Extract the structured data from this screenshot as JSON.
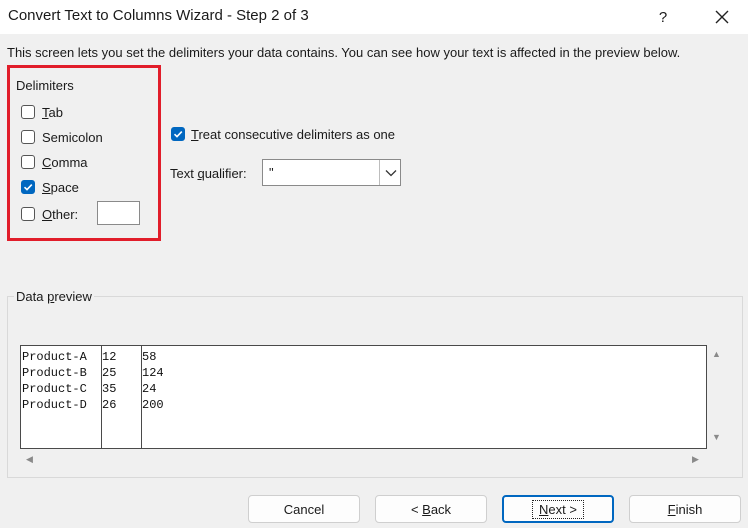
{
  "window": {
    "title": "Convert Text to Columns Wizard - Step 2 of 3",
    "help": "?"
  },
  "description": "This screen lets you set the delimiters your data contains.  You can see how your text is affected in the preview below.",
  "delimiters": {
    "label": "Delimiters",
    "tab": {
      "key": "T",
      "rest": "ab",
      "checked": false
    },
    "semicolon": {
      "key": "S",
      "rest": "emicolon",
      "checked": false
    },
    "comma": {
      "key": "C",
      "rest": "omma",
      "checked": false
    },
    "space": {
      "key": "S",
      "rest": "pace",
      "checked": true
    },
    "other": {
      "key": "O",
      "rest": "ther:",
      "checked": false,
      "value": ""
    }
  },
  "consecutive": {
    "key": "T",
    "rest": "reat consecutive delimiters as one",
    "checked": true
  },
  "qualifier": {
    "pre": "Text ",
    "key": "q",
    "post": "ualifier:",
    "value": "\""
  },
  "preview": {
    "label_pre": "Data ",
    "label_key": "p",
    "label_post": "review",
    "columns": [
      [
        "Product-A",
        "Product-B",
        "Product-C",
        "Product-D"
      ],
      [
        "12",
        "25",
        "35",
        "26"
      ],
      [
        "58",
        "124",
        "24",
        "200"
      ]
    ]
  },
  "buttons": {
    "cancel": "Cancel",
    "back_pre": "< ",
    "back_key": "B",
    "back_post": "ack",
    "next_key": "N",
    "next_post": "ext >",
    "finish_key": "F",
    "finish_post": "inish"
  },
  "colors": {
    "accent": "#0067c0",
    "highlight": "#e11d2a"
  }
}
